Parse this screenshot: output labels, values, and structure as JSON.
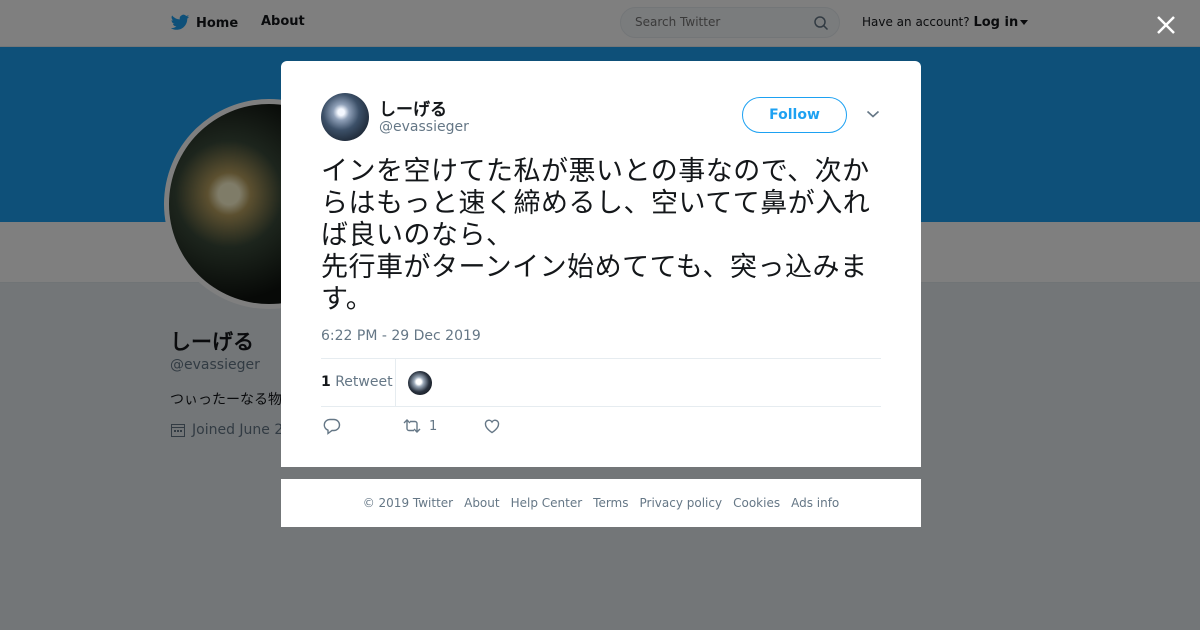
{
  "topbar": {
    "home_label": "Home",
    "about_label": "About",
    "search_placeholder": "Search Twitter",
    "have_account": "Have an account?",
    "login_label": "Log in"
  },
  "profile": {
    "name": "しーげる",
    "handle": "@evassieger",
    "bio": "つぃったーなる物",
    "joined": "Joined June 2"
  },
  "tweet": {
    "name": "しーげる",
    "handle": "@evassieger",
    "follow_label": "Follow",
    "text": "インを空けてた私が悪いとの事なので、次からはもっと速く締めるし、空いてて鼻が入れば良いのなら、\n先行車がターンイン始めてても、突っ込みます。",
    "timestamp": "6:22 PM - 29 Dec 2019",
    "retweet_count": "1",
    "retweet_label": "Retweet",
    "action_retweet_count": "1"
  },
  "footer": {
    "links": [
      "© 2019 Twitter",
      "About",
      "Help Center",
      "Terms",
      "Privacy policy",
      "Cookies",
      "Ads info"
    ]
  },
  "colors": {
    "accent": "#1da1f2",
    "text": "#14171a",
    "muted": "#657786"
  },
  "icons": [
    "twitter-bird-icon",
    "search-icon",
    "close-icon",
    "chevron-down-icon",
    "reply-icon",
    "retweet-icon",
    "like-icon",
    "calendar-icon"
  ]
}
